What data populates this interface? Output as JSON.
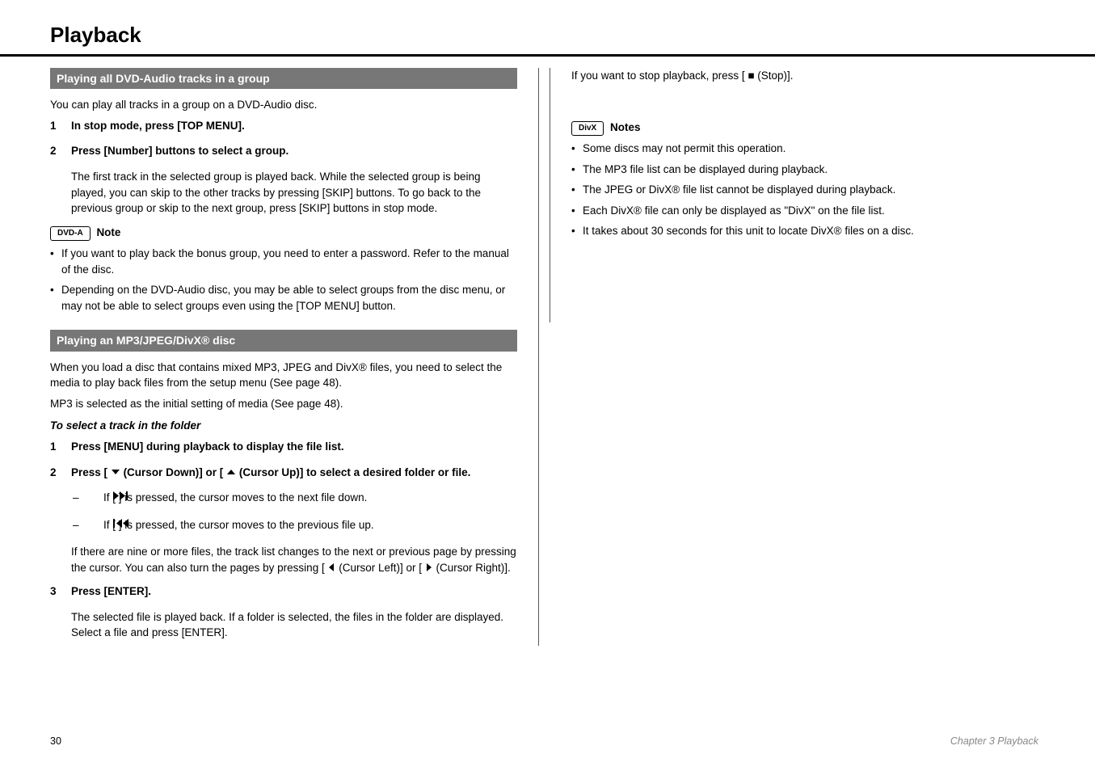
{
  "pageTitle": "Playback",
  "left": {
    "section1": {
      "bar": "Playing all DVD-Audio tracks in a group",
      "intro": "You can play all tracks in a group on a DVD-Audio disc.",
      "steps": [
        {
          "n": "1",
          "t": "In stop mode, press [TOP MENU]."
        },
        {
          "n": "2",
          "t": "Press [Number] buttons to select a group."
        }
      ],
      "sub": "The first track in the selected group is played back. While the selected group is being played, you can skip to the other tracks by pressing [SKIP] buttons. To go back to the previous group or skip to the next group, press [SKIP] buttons in stop mode.",
      "tag": "DVD-A",
      "noteLabel": "Note",
      "notes": [
        "If you want to play back the bonus group, you need to enter a password. Refer to the manual of the disc.",
        "Depending on the DVD-Audio disc, you may be able to select groups from the disc menu, or may not be able to select groups even using the [TOP MENU] button."
      ]
    },
    "section2": {
      "bar": "Playing an MP3/JPEG/DivX® disc",
      "intro1": "When you load a disc that contains mixed MP3, JPEG and DivX® files, you need to select the media to play back files from the setup menu (See page 48).",
      "intro2": "MP3 is selected as the initial setting of media (See page 48).",
      "folderHeading": "To select a track in the folder",
      "step1": {
        "n": "1",
        "t": "Press [MENU] during playback to display the file list."
      },
      "step2Lead": {
        "n": "2",
        "t1": "Press [",
        "t2": " (Cursor Down)] or [",
        "t3": " (Cursor Up)] to select a desired folder or file."
      },
      "sub2items": [
        {
          "icon": "next",
          "t": "If [       ] is pressed, the cursor moves to the next file down."
        },
        {
          "icon": "prev",
          "t": "If [       ] is pressed, the cursor moves to the previous file up."
        }
      ],
      "sub2after": "If there are nine or more files, the track list changes to the next or previous page by pressing the cursor. You can also turn the pages by pressing [    (Cursor Left)] or [    (Cursor Right)].",
      "step3": {
        "n": "3",
        "t": "Press [ENTER]."
      },
      "sub3": "The selected file is played back. If a folder is selected, the files in the folder are displayed. Select a file and press [ENTER]."
    }
  },
  "right": {
    "tag": "DivX",
    "noteLabel": "Notes",
    "notes": [
      "Some discs may not permit this operation.",
      "The MP3 file list can be displayed during playback.",
      "The JPEG or DivX® file list cannot be displayed during playback.",
      "Each DivX® file can only be displayed as \"DivX\" on the file list.",
      "It takes about 30 seconds for this unit to locate DivX® files on a disc."
    ]
  },
  "footer": {
    "page": "30",
    "chapter": "Chapter 3    Playback"
  }
}
